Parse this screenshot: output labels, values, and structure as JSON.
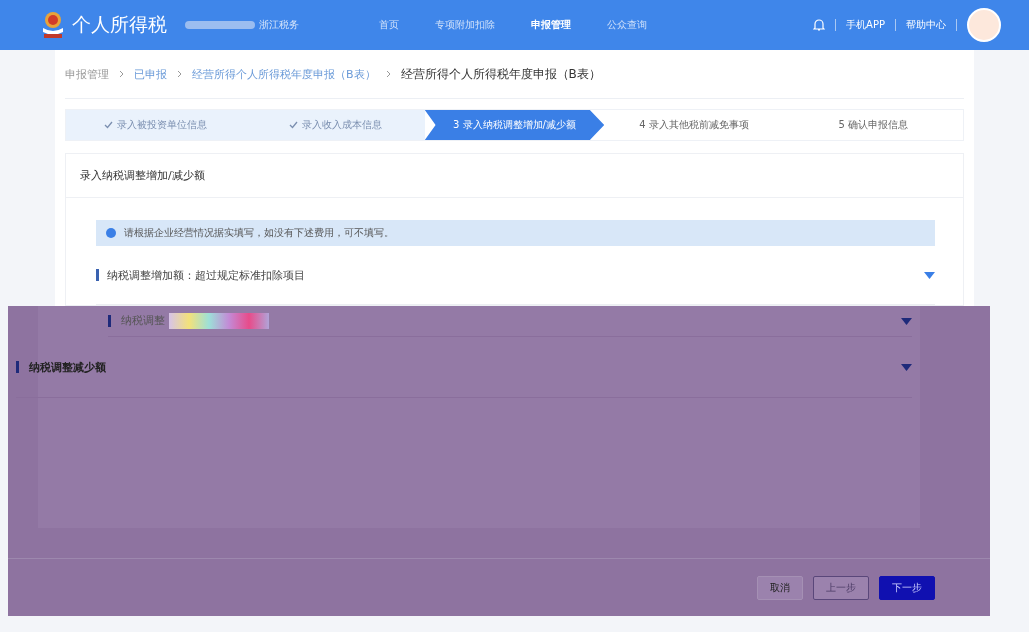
{
  "header": {
    "app_title": "个人所得税",
    "region": "浙江税务",
    "nav": [
      {
        "label": "首页",
        "selected": false
      },
      {
        "label": "专项附加扣除",
        "selected": false
      },
      {
        "label": "申报管理",
        "selected": true
      },
      {
        "label": "公众查询",
        "selected": false
      }
    ],
    "links": [
      "手机APP",
      "帮助中心"
    ]
  },
  "breadcrumb": [
    {
      "label": "申报管理",
      "kind": "link"
    },
    {
      "label": "已申报",
      "kind": "link"
    },
    {
      "label": "经营所得个人所得税年度申报（B表）",
      "kind": "link"
    },
    {
      "label": "经营所得个人所得税年度申报（B表）",
      "kind": "current"
    }
  ],
  "steps": [
    {
      "label": "录入被投资单位信息",
      "done": true,
      "selected": false
    },
    {
      "label": "录入收入成本信息",
      "done": true,
      "selected": false
    },
    {
      "label": "3 录入纳税调整增加/减少额",
      "done": false,
      "selected": true
    },
    {
      "label": "4 录入其他税前减免事项",
      "done": false,
      "selected": false
    },
    {
      "label": "5 确认申报信息",
      "done": false,
      "selected": false
    }
  ],
  "panel": {
    "title": "录入纳税调整增加/减少额",
    "notice": "请根据企业经营情况据实填写，如没有下述费用，可不填写。",
    "sections": [
      {
        "title": "纳税调整增加额：超过规定标准扣除项目",
        "expanded": false,
        "kind": "plain"
      },
      {
        "title": "纳税调整",
        "expanded": false,
        "kind": "glitched"
      },
      {
        "title": "纳税调整减少额",
        "expanded": false,
        "kind": "tinted"
      }
    ]
  },
  "footer": {
    "buttons": [
      {
        "label": "取消",
        "kind": "default"
      },
      {
        "label": "上一步",
        "kind": "outline"
      },
      {
        "label": "下一步",
        "kind": "primary"
      }
    ]
  }
}
